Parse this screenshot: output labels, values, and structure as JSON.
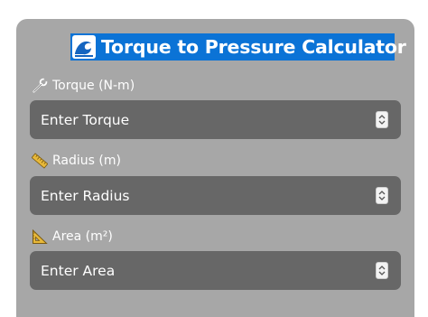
{
  "title": {
    "text": "Torque to Pressure Calculator",
    "icon": "wave-icon"
  },
  "fields": [
    {
      "label": "Torque (N-m)",
      "icon": "wrench-icon",
      "placeholder": "Enter Torque"
    },
    {
      "label": "Radius (m)",
      "icon": "ruler-icon",
      "placeholder": "Enter Radius"
    },
    {
      "label": "Area (m²)",
      "icon": "triangle-ruler-icon",
      "placeholder": "Enter Area"
    }
  ],
  "colors": {
    "card_bg": "#a7a7a7",
    "title_bg": "#0b73d6",
    "field_bg": "#676767",
    "text": "#ffffff"
  }
}
